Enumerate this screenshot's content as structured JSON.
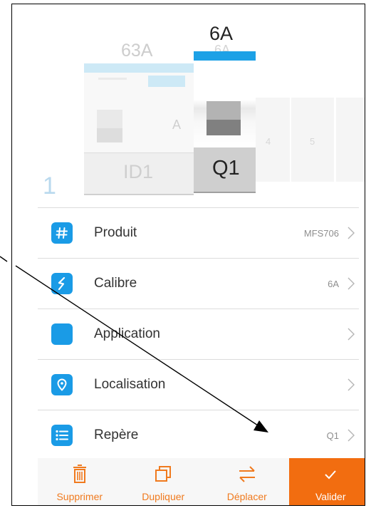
{
  "panel": {
    "row_number": "1",
    "ghost_slots": [
      "4",
      "5"
    ],
    "modules": [
      {
        "label": "ID1",
        "rating": "63A",
        "rating_unit": "A",
        "state": "inactive"
      },
      {
        "label": "Q1",
        "rating": "6A",
        "rating_ghost": "6A",
        "state": "selected"
      }
    ]
  },
  "list": {
    "items": [
      {
        "label": "Produit",
        "value": "MFS706",
        "icon": "hash-icon"
      },
      {
        "label": "Calibre",
        "value": "6A",
        "icon": "lightning-icon"
      },
      {
        "label": "Application",
        "value": "",
        "icon": "blank-icon"
      },
      {
        "label": "Localisation",
        "value": "",
        "icon": "location-pin-icon"
      },
      {
        "label": "Repère",
        "value": "Q1",
        "icon": "list-icon"
      }
    ]
  },
  "toolbar": {
    "delete_label": "Supprimer",
    "duplicate_label": "Dupliquer",
    "move_label": "Déplacer",
    "validate_label": "Valider"
  },
  "colors": {
    "accent_blue": "#1a9be6",
    "accent_orange": "#f26d10",
    "selected_bar": "#1da1e6"
  }
}
